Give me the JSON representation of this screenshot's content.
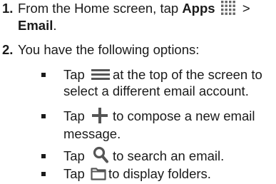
{
  "steps": [
    {
      "number": "1.",
      "text_before": "From the Home screen, tap ",
      "bold1": "Apps",
      "icon": "apps-grid-icon",
      "text_mid": " > ",
      "bold2": "Email",
      "text_after": "."
    },
    {
      "number": "2.",
      "text": "You have the following options:"
    }
  ],
  "options": [
    {
      "lead": "Tap",
      "icon": "menu-icon",
      "text": "at the top of the screen to select a different email account."
    },
    {
      "lead": "Tap",
      "icon": "plus-icon",
      "text": "to compose a new email message."
    },
    {
      "lead": "Tap",
      "icon": "search-icon",
      "text": "to search an email."
    },
    {
      "lead": "Tap",
      "icon": "folder-icon",
      "text": "to display folders."
    }
  ],
  "colors": {
    "text": "#1a1a1a",
    "icon": "#555555"
  }
}
